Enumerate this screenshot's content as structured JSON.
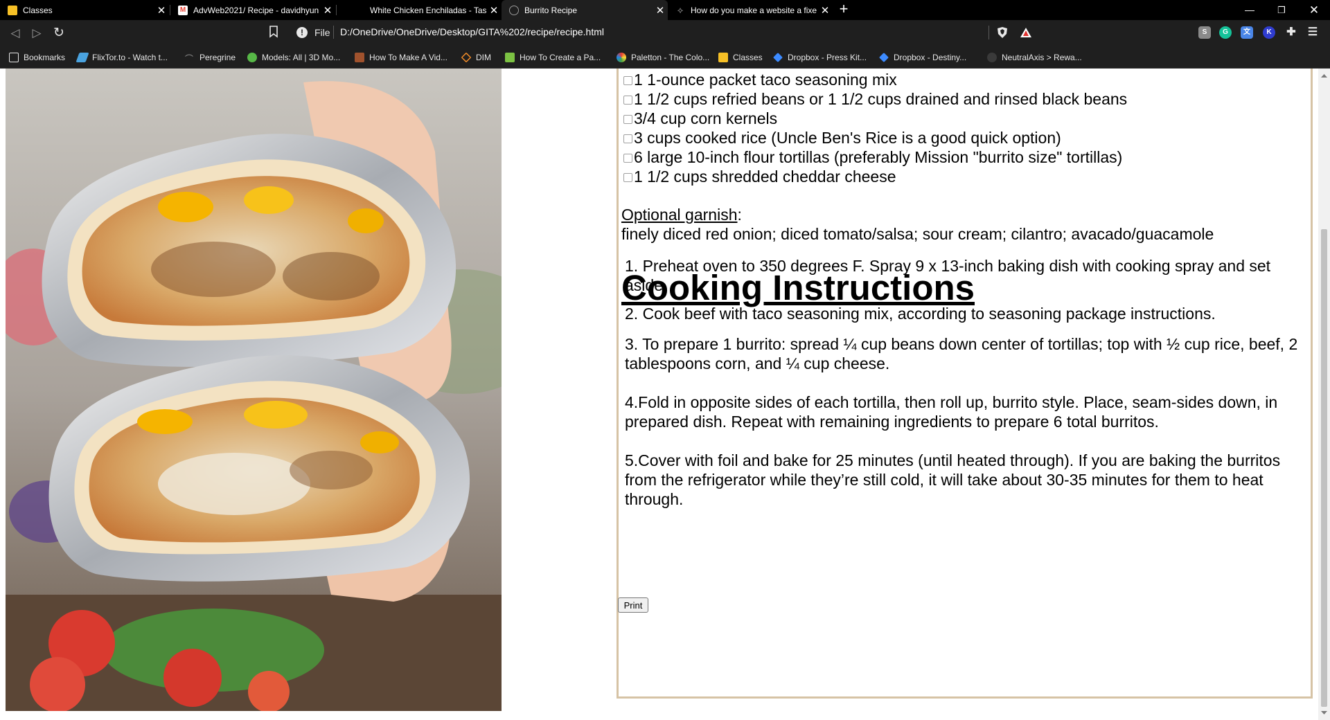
{
  "tabs": [
    {
      "label": "Classes",
      "favicon": "google-classroom-icon",
      "color": "#f6c026"
    },
    {
      "label": "AdvWeb2021/ Recipe - davidhyun",
      "favicon": "gmail-icon",
      "color": "#ea4335"
    },
    {
      "label": "White Chicken Enchiladas - Taste a",
      "favicon": "taste-icon",
      "color": "#2a2a2a"
    },
    {
      "label": "Burrito Recipe",
      "favicon": "globe-icon",
      "color": "#6a6a6a"
    },
    {
      "label": "How do you make a website a fixe",
      "favicon": "stackoverflow-icon",
      "color": "#f48024"
    }
  ],
  "address": {
    "scheme_label": "File",
    "url": "D:/OneDrive/OneDrive/Desktop/GITA%202/recipe/recipe.html"
  },
  "bookmarks": [
    {
      "label": "Bookmarks",
      "color": "#e8e8e8"
    },
    {
      "label": "FlixTor.to - Watch t...",
      "color": "#4aa3df"
    },
    {
      "label": "Peregrine",
      "color": "#9a9a9a"
    },
    {
      "label": "Models: All | 3D Mo...",
      "color": "#57b847"
    },
    {
      "label": "How To Make A Vid...",
      "color": "#a0522d"
    },
    {
      "label": "DIM",
      "color": "#f28c28"
    },
    {
      "label": "How To Create a Pa...",
      "color": "#7cc243"
    },
    {
      "label": "Paletton - The Colo...",
      "color": "#e8e8e8"
    },
    {
      "label": "Classes",
      "color": "#f6c026"
    },
    {
      "label": "Dropbox - Press Kit...",
      "color": "#3d8bff"
    },
    {
      "label": "Dropbox - Destiny...",
      "color": "#3d8bff"
    },
    {
      "label": "NeutralAxis > Rewa...",
      "color": "#3a3a3a"
    }
  ],
  "recipe": {
    "ingredients": [
      "1 1-ounce packet taco seasoning mix",
      "1 1/2 cups refried beans or 1 1/2 cups drained and rinsed black beans",
      "3/4 cup corn kernels",
      "3 cups cooked rice (Uncle Ben's Rice is a good quick option)",
      "6 large 10-inch flour tortillas (preferably Mission \"burrito size\" tortillas)",
      "1 1/2 cups shredded cheddar cheese"
    ],
    "garnish_title": "Optional garnish",
    "garnish_colon": ":",
    "garnish_text": "finely diced red onion; diced tomato/salsa; sour cream; cilantro; avacado/guacamole",
    "instructions_title": "Cooking Instructions",
    "steps": [
      "1. Preheat oven to 350 degrees F. Spray 9 x 13-inch baking dish with cooking spray and set aside.",
      "2. Cook beef with taco seasoning mix, according to seasoning package instructions.",
      "3. To prepare 1 burrito: spread ¼ cup beans down center of tortillas; top with ½ cup rice, beef, 2 tablespoons corn, and ¼ cup cheese.",
      "4.Fold in opposite sides of each tortilla, then roll up, burrito style. Place, seam-sides down, in prepared dish. Repeat with remaining ingredients to prepare 6 total burritos.",
      "5.Cover with foil and bake for 25 minutes (until heated through). If you are baking the burritos from the refrigerator while they’re still cold, it will take about 30-35 minutes for them to heat through."
    ],
    "print_label": "Print"
  },
  "colors": {
    "panel_border": "#d6c3a5",
    "chrome_bg": "#1f1f1f",
    "tabbar_bg": "#000000"
  }
}
